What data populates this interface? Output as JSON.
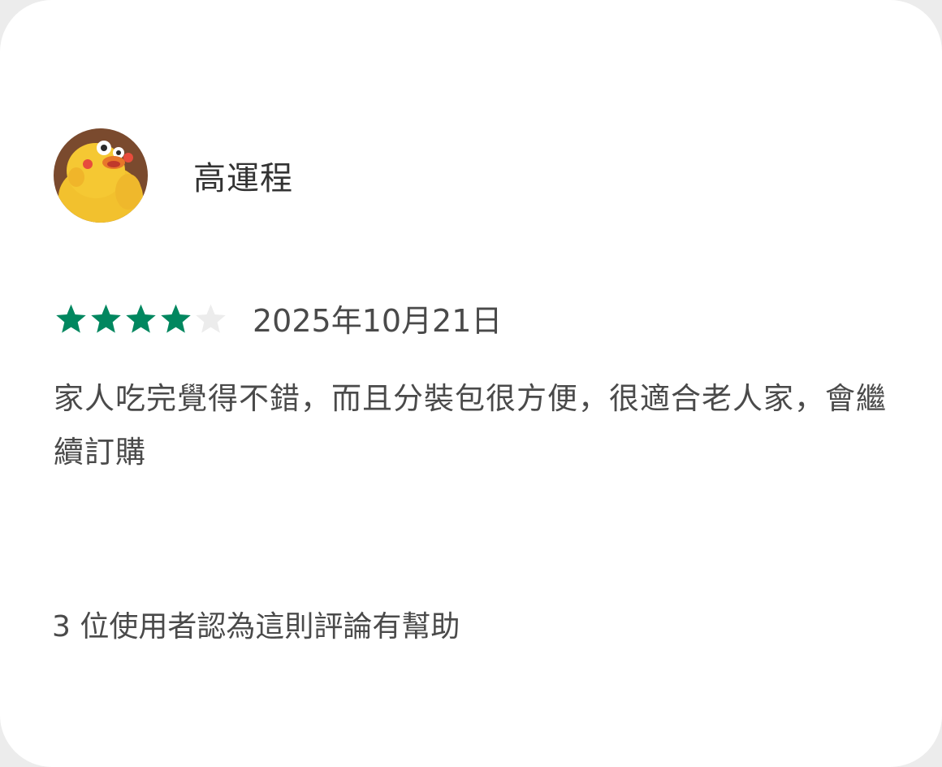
{
  "review": {
    "reviewer_name": "高運程",
    "avatar_icon": "yellow-chick-avatar",
    "rating": 4,
    "rating_max": 5,
    "date": "2025年10月21日",
    "text": "家人吃完覺得不錯，而且分裝包很方便，很適合老人家，會繼續訂購",
    "helpful_text": "3 位使用者認為這則評論有幫助"
  },
  "colors": {
    "star_filled": "#01875f",
    "star_empty": "#ececec",
    "text": "#4a4a4a",
    "card_bg": "#ffffff"
  }
}
